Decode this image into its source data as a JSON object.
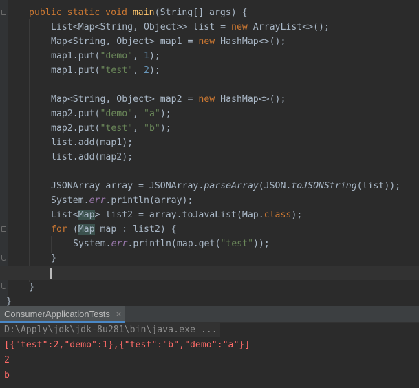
{
  "editor": {
    "lines": {
      "l1": {
        "kw1": "public ",
        "kw2": "static ",
        "kw3": "void ",
        "fn": "main",
        "rest": "(String[] args) {"
      },
      "l2": {
        "a": "List<Map<String, Object>> list = ",
        "kw": "new ",
        "b": "ArrayList<>();"
      },
      "l3": {
        "a": "Map<String, Object> map1 = ",
        "kw": "new ",
        "b": "HashMap<>();"
      },
      "l4": {
        "a": "map1.put(",
        "s": "\"demo\"",
        "c": ", ",
        "n": "1",
        "e": ");"
      },
      "l5": {
        "a": "map1.put(",
        "s": "\"test\"",
        "c": ", ",
        "n": "2",
        "e": ");"
      },
      "l7": {
        "a": "Map<String, Object> map2 = ",
        "kw": "new ",
        "b": "HashMap<>();"
      },
      "l8": {
        "a": "map2.put(",
        "s1": "\"demo\"",
        "c": ", ",
        "s2": "\"a\"",
        "e": ");"
      },
      "l9": {
        "a": "map2.put(",
        "s1": "\"test\"",
        "c": ", ",
        "s2": "\"b\"",
        "e": ");"
      },
      "l10": {
        "a": "list.add(map1);"
      },
      "l11": {
        "a": "list.add(map2);"
      },
      "l13": {
        "a": "JSONArray array = JSONArray.",
        "m1": "parseArray",
        "b": "(JSON.",
        "m2": "toJSONString",
        "e": "(list));"
      },
      "l14": {
        "a": "System.",
        "f": "err",
        "b": ".println(array);"
      },
      "l15": {
        "a": "List<",
        "h": "Map",
        "b": "> list2 = array.toJavaList(Map.",
        "kw": "class",
        "e": ");"
      },
      "l16": {
        "kw": "for ",
        "a": "(",
        "h": "Map",
        "b": " map : list2) {"
      },
      "l17": {
        "a": "System.",
        "f": "err",
        "b": ".println(map.get(",
        "s": "\"test\"",
        "e": "));"
      },
      "l18": {
        "a": "}"
      },
      "l20": {
        "a": "}"
      },
      "l21": {
        "a": "}"
      }
    }
  },
  "run_panel": {
    "tab_label": "ConsumerApplicationTests",
    "tab_close": "×",
    "command": "D:\\Apply\\jdk\\jdk-8u281\\bin\\java.exe ...",
    "output": [
      "[{\"test\":2,\"demo\":1},{\"test\":\"b\",\"demo\":\"a\"}]",
      "2",
      "b"
    ]
  }
}
